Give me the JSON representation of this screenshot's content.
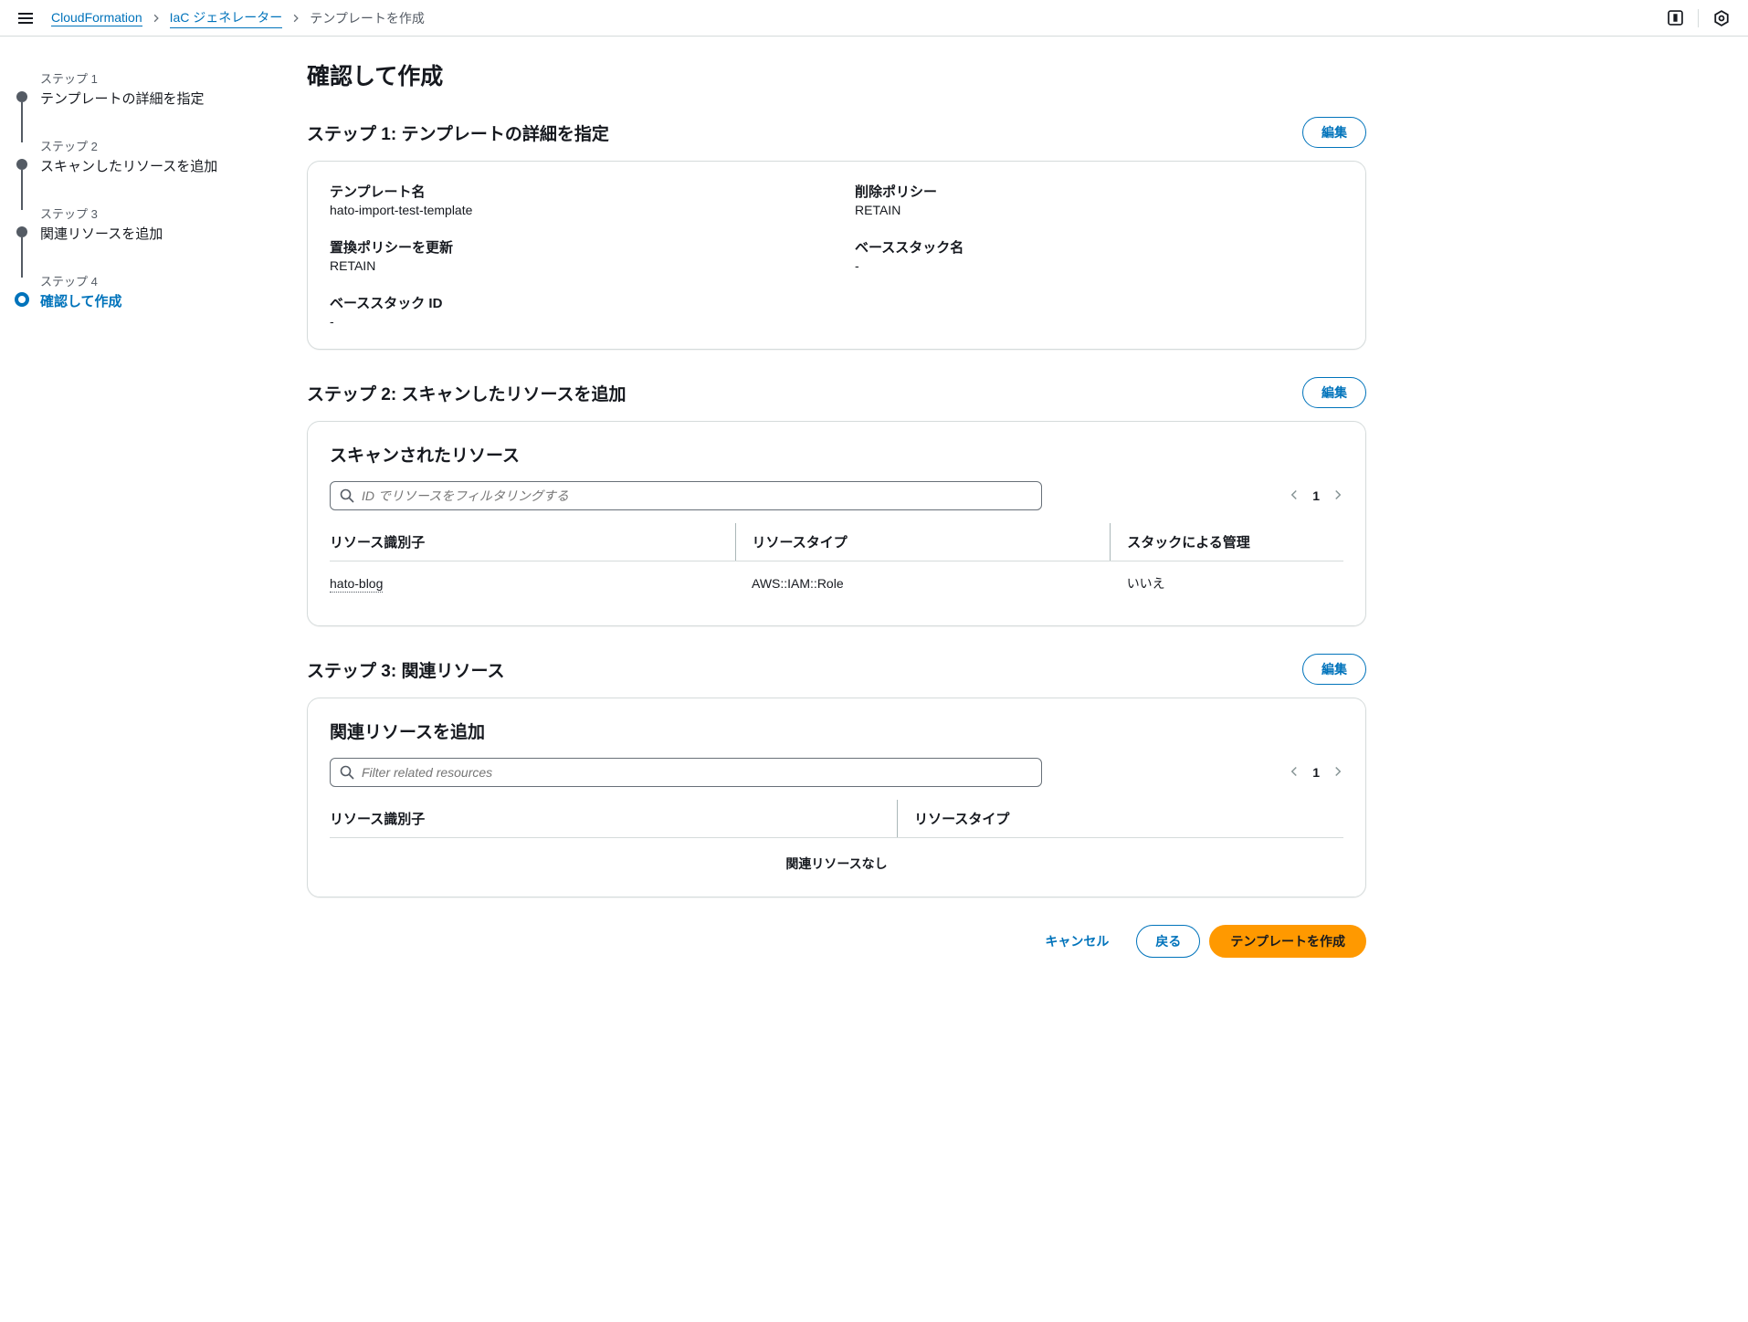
{
  "breadcrumb": {
    "l1": "CloudFormation",
    "l2": "IaC ジェネレーター",
    "l3": "テンプレートを作成"
  },
  "sidebar": {
    "steps": [
      {
        "label": "ステップ 1",
        "title": "テンプレートの詳細を指定"
      },
      {
        "label": "ステップ 2",
        "title": "スキャンしたリソースを追加"
      },
      {
        "label": "ステップ 3",
        "title": "関連リソースを追加"
      },
      {
        "label": "ステップ 4",
        "title": "確認して作成"
      }
    ]
  },
  "page_title": "確認して作成",
  "common": {
    "edit_label": "編集"
  },
  "step1": {
    "heading": "ステップ 1: テンプレートの詳細を指定",
    "kv": {
      "template_name_k": "テンプレート名",
      "template_name_v": "hato-import-test-template",
      "delete_policy_k": "削除ポリシー",
      "delete_policy_v": "RETAIN",
      "replace_policy_k": "置換ポリシーを更新",
      "replace_policy_v": "RETAIN",
      "base_stack_name_k": "ベーススタック名",
      "base_stack_name_v": "-",
      "base_stack_id_k": "ベーススタック ID",
      "base_stack_id_v": "-"
    }
  },
  "step2": {
    "heading": "ステップ 2: スキャンしたリソースを追加",
    "panel_title": "スキャンされたリソース",
    "search_placeholder": "ID でリソースをフィルタリングする",
    "page_num": "1",
    "cols": {
      "id": "リソース識別子",
      "type": "リソースタイプ",
      "managed": "スタックによる管理"
    },
    "rows": [
      {
        "id": "hato-blog",
        "type": "AWS::IAM::Role",
        "managed": "いいえ"
      }
    ]
  },
  "step3": {
    "heading": "ステップ 3: 関連リソース",
    "panel_title": "関連リソースを追加",
    "search_placeholder": "Filter related resources",
    "page_num": "1",
    "cols": {
      "id": "リソース識別子",
      "type": "リソースタイプ"
    },
    "empty": "関連リソースなし"
  },
  "footer": {
    "cancel": "キャンセル",
    "back": "戻る",
    "create": "テンプレートを作成"
  }
}
